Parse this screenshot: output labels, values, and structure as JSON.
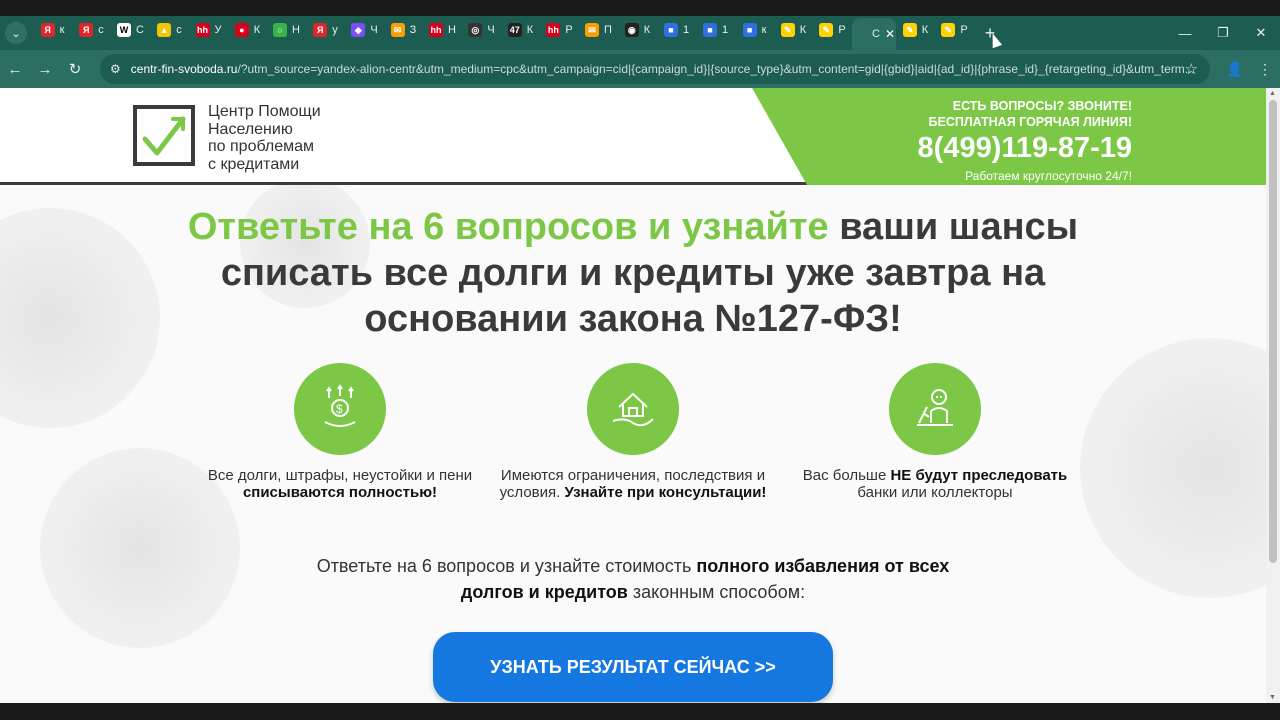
{
  "tabs": [
    {
      "title": "к",
      "icon": "yandex-icon",
      "fav": "Я",
      "color": "#e0262a"
    },
    {
      "title": "с",
      "icon": "yandex-icon",
      "fav": "Я",
      "color": "#e0262a"
    },
    {
      "title": "С",
      "icon": "wikipedia-icon",
      "fav": "W",
      "color": "#ffffff"
    },
    {
      "title": "с",
      "icon": "image-icon",
      "fav": "▲",
      "color": "#f5c400"
    },
    {
      "title": "У",
      "icon": "hh-icon",
      "fav": "hh",
      "color": "#d6001c"
    },
    {
      "title": "К",
      "icon": "blob-icon",
      "fav": "●",
      "color": "#d6001c"
    },
    {
      "title": "Н",
      "icon": "ring-icon",
      "fav": "○",
      "color": "#3bb34a"
    },
    {
      "title": "у",
      "icon": "yandex-icon",
      "fav": "Я",
      "color": "#e0262a"
    },
    {
      "title": "Ч",
      "icon": "alice-icon",
      "fav": "◆",
      "color": "#7b4dff"
    },
    {
      "title": "З",
      "icon": "mail-icon",
      "fav": "✉",
      "color": "#ff9d00"
    },
    {
      "title": "Н",
      "icon": "hh-icon",
      "fav": "hh",
      "color": "#d6001c"
    },
    {
      "title": "Ч",
      "icon": "openai-icon",
      "fav": "◎",
      "color": "#333333"
    },
    {
      "title": "К",
      "icon": "app-icon",
      "fav": "47",
      "color": "#222222"
    },
    {
      "title": "Р",
      "icon": "hh-icon",
      "fav": "hh",
      "color": "#d6001c"
    },
    {
      "title": "П",
      "icon": "mail-icon",
      "fav": "✉",
      "color": "#ff9d00"
    },
    {
      "title": "К",
      "icon": "circle-logo-icon",
      "fav": "◉",
      "color": "#222222"
    },
    {
      "title": "1",
      "icon": "cube-icon",
      "fav": "■",
      "color": "#2f6fe0"
    },
    {
      "title": "1",
      "icon": "cube-icon",
      "fav": "■",
      "color": "#2f6fe0"
    },
    {
      "title": "к",
      "icon": "cube-icon",
      "fav": "■",
      "color": "#2f6fe0"
    },
    {
      "title": "К",
      "icon": "banana-icon",
      "fav": "✎",
      "color": "#ffd200"
    },
    {
      "title": "Р",
      "icon": "banana-icon",
      "fav": "✎",
      "color": "#ffd200"
    },
    {
      "title": "С",
      "icon": "page-icon",
      "fav": "",
      "color": "#2a6f61",
      "active": true
    },
    {
      "title": "К",
      "icon": "banana-icon",
      "fav": "✎",
      "color": "#ffd200"
    },
    {
      "title": "Р",
      "icon": "banana-icon",
      "fav": "✎",
      "color": "#ffd200"
    }
  ],
  "address": {
    "host": "centr-fin-svoboda.ru",
    "path": "/?utm_source=yandex-alion-centr&utm_medium=cpc&utm_campaign=cid|{campaign_id}|{source_type}&utm_content=gid|{gbid}|aid|{ad_id}|{phrase_id}_{retargeting_id}&utm_term..."
  },
  "logo": {
    "line1": "Центр Помощи",
    "line2": "Населению",
    "line3": "по проблемам",
    "line4": "с кредитами"
  },
  "hotline": {
    "line1": "ЕСТЬ ВОПРОСЫ? ЗВОНИТЕ!",
    "line2": "БЕСПЛАТНАЯ ГОРЯЧАЯ ЛИНИЯ!",
    "phone": "8(499)119-87-19",
    "hours": "Работаем круглосуточно 24/7!"
  },
  "headline": {
    "highlight": "Ответьте на 6 вопросов и узнайте",
    "rest": " ваши шансы списать все долги и кредиты уже завтра на основании закона №127-ФЗ!"
  },
  "features": [
    {
      "icon": "money-icon",
      "text": "Все долги, штрафы, неустойки и пени",
      "bold": "списываются полностью!"
    },
    {
      "icon": "house-hand-icon",
      "text": "Имеются ограничения, последствия и условия.",
      "bold": "Узнайте при консультации!"
    },
    {
      "icon": "collector-icon",
      "text_before": "Вас больше",
      "bold": "НЕ будут преследовать",
      "text_after": "банки или коллекторы"
    }
  ],
  "subtitle": {
    "part1": "Ответьте на 6 вопросов и узнайте стоимость",
    "bold": "полного избавления от всех долгов и кредитов",
    "part2": "законным способом:"
  },
  "cta": {
    "label": "УЗНАТЬ РЕЗУЛЬТАТ СЕЙЧАС >>"
  },
  "colors": {
    "brand_green": "#7cc846",
    "cta_blue": "#1478e0",
    "chrome_teal": "#2a6f61"
  }
}
